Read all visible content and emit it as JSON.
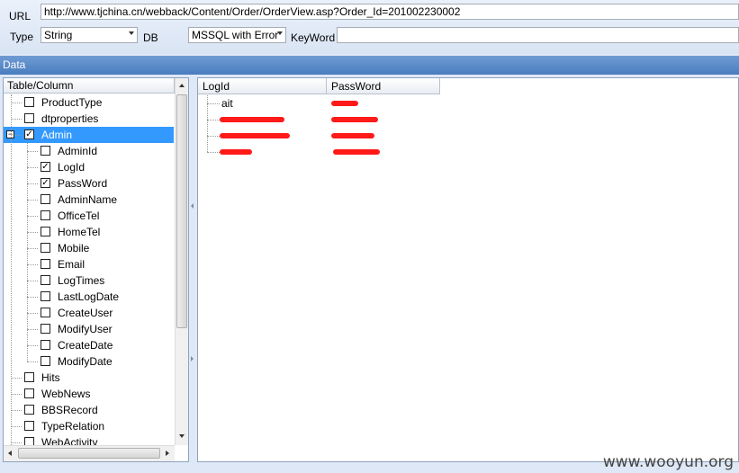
{
  "toolbar": {
    "url_label": "URL",
    "url_value": "http://www.tjchina.cn/webback/Content/Order/OrderView.asp?Order_Id=201002230002",
    "type_label": "Type",
    "type_value": "String",
    "db_label": "DB",
    "db_value": "MSSQL with Error",
    "keyword_label": "KeyWord",
    "keyword_value": ""
  },
  "data_panel": {
    "title": "Data"
  },
  "tree": {
    "header": "Table/Column",
    "nodes": [
      {
        "label": "ProductType",
        "level": 0,
        "checked": false
      },
      {
        "label": "dtproperties",
        "level": 0,
        "checked": false
      },
      {
        "label": "Admin",
        "level": 0,
        "checked": true,
        "expanded": true,
        "selected": true
      },
      {
        "label": "AdminId",
        "level": 1,
        "checked": false
      },
      {
        "label": "LogId",
        "level": 1,
        "checked": true
      },
      {
        "label": "PassWord",
        "level": 1,
        "checked": true
      },
      {
        "label": "AdminName",
        "level": 1,
        "checked": false
      },
      {
        "label": "OfficeTel",
        "level": 1,
        "checked": false
      },
      {
        "label": "HomeTel",
        "level": 1,
        "checked": false
      },
      {
        "label": "Mobile",
        "level": 1,
        "checked": false
      },
      {
        "label": "Email",
        "level": 1,
        "checked": false
      },
      {
        "label": "LogTimes",
        "level": 1,
        "checked": false
      },
      {
        "label": "LastLogDate",
        "level": 1,
        "checked": false
      },
      {
        "label": "CreateUser",
        "level": 1,
        "checked": false
      },
      {
        "label": "ModifyUser",
        "level": 1,
        "checked": false
      },
      {
        "label": "CreateDate",
        "level": 1,
        "checked": false
      },
      {
        "label": "ModifyDate",
        "level": 1,
        "checked": false
      },
      {
        "label": "Hits",
        "level": 0,
        "checked": false
      },
      {
        "label": "WebNews",
        "level": 0,
        "checked": false
      },
      {
        "label": "BBSRecord",
        "level": 0,
        "checked": false
      },
      {
        "label": "TypeRelation",
        "level": 0,
        "checked": false
      },
      {
        "label": "WebActivity",
        "level": 0,
        "checked": false
      }
    ],
    "collapse_glyph": "−",
    "check_glyph": "✓"
  },
  "grid": {
    "columns": [
      "LogId",
      "PassWord"
    ],
    "rows": [
      {
        "logid": "ait",
        "password": ""
      },
      {
        "logid": "",
        "password": ""
      },
      {
        "logid": "",
        "password": ""
      },
      {
        "logid": "",
        "password": ""
      }
    ],
    "redaction_color": "#ff1a1a"
  },
  "watermark": "www.wooyun.org",
  "colors": {
    "selection": "#3399ff",
    "header_bar": "#4a7dbf"
  }
}
